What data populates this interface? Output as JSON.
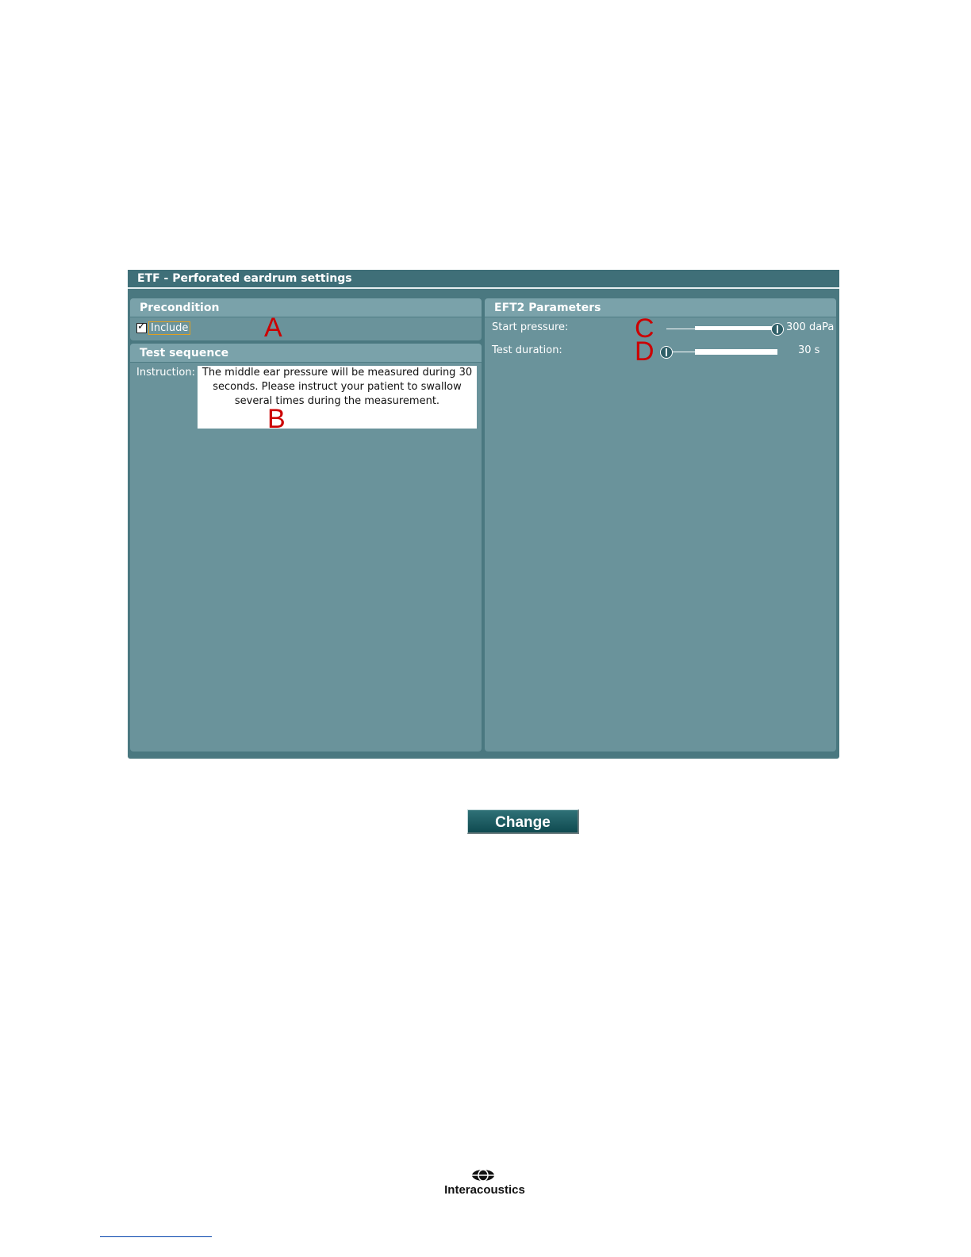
{
  "window": {
    "title": "ETF - Perforated eardrum settings"
  },
  "precondition": {
    "header": "Precondition",
    "include_label": "Include",
    "include_checked": true,
    "marker": "A"
  },
  "test_sequence": {
    "header": "Test sequence",
    "instruction_label": "Instruction:",
    "instruction_text": "The middle ear pressure will be measured during 30 seconds. Please instruct your patient to swallow several times during the measurement.",
    "marker": "B"
  },
  "eft2": {
    "header": "EFT2 Parameters",
    "start_pressure": {
      "label": "Start pressure:",
      "value": "300 daPa",
      "marker": "C",
      "slider_fraction": 1.0
    },
    "test_duration": {
      "label": "Test duration:",
      "value": "30 s",
      "marker": "D",
      "slider_fraction": 0.0
    }
  },
  "change_button": {
    "label": "Change"
  },
  "logo": {
    "text": "Interacoustics",
    "icon": "interacoustics-logo-icon"
  },
  "colors": {
    "window_bg": "#4a7880",
    "panel_bg": "#6a939b",
    "marker": "#cc0000",
    "button": "#1f5f65"
  }
}
